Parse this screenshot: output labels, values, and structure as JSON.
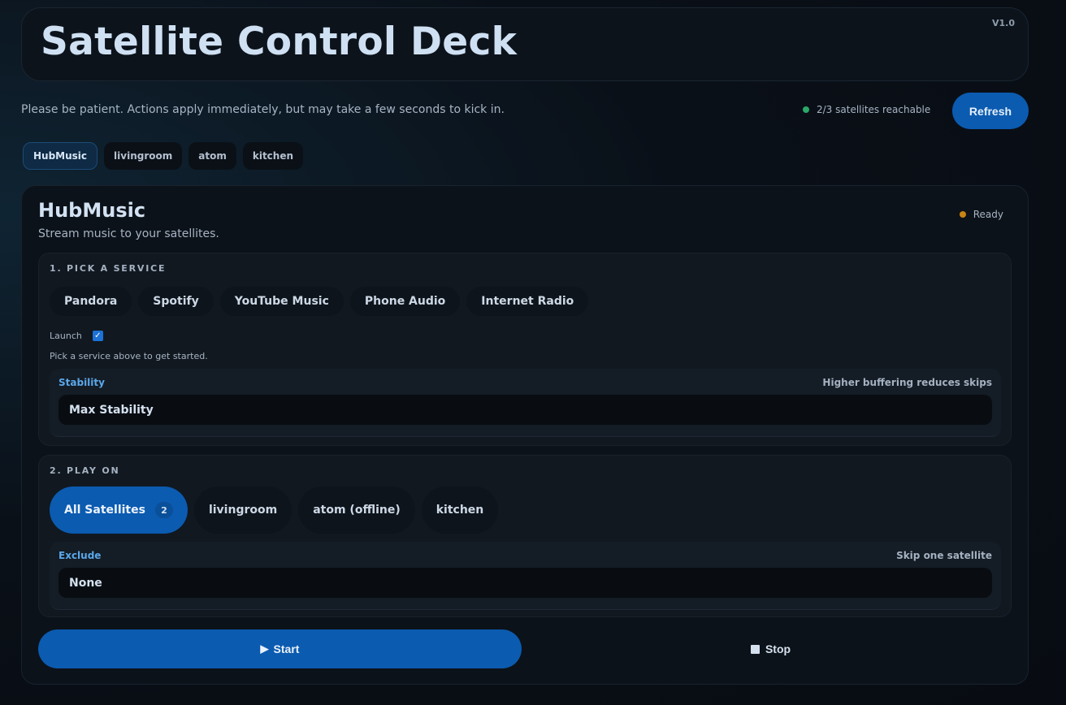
{
  "header": {
    "title": "Satellite Control Deck",
    "version": "V1.0"
  },
  "notice": "Please be patient. Actions apply immediately, but may take a few seconds to kick in.",
  "reachability": {
    "text": "2/3 satellites reachable",
    "color": "#2aa86a"
  },
  "refresh_label": "Refresh",
  "tabs": [
    {
      "label": "HubMusic",
      "active": true
    },
    {
      "label": "livingroom",
      "active": false
    },
    {
      "label": "atom",
      "active": false
    },
    {
      "label": "kitchen",
      "active": false
    }
  ],
  "panel": {
    "title": "HubMusic",
    "subtitle": "Stream music to your satellites.",
    "status": {
      "label": "Ready",
      "color": "#c98512"
    },
    "section1": {
      "title": "1. PICK A SERVICE",
      "services": [
        "Pandora",
        "Spotify",
        "YouTube Music",
        "Phone Audio",
        "Internet Radio"
      ],
      "launch_label": "Launch",
      "launch_checked": true,
      "hint": "Pick a service above to get started.",
      "stability": {
        "label": "Stability",
        "hint": "Higher buffering reduces skips",
        "value": "Max Stability"
      }
    },
    "section2": {
      "title": "2. PLAY ON",
      "targets": [
        {
          "label": "All Satellites",
          "count": "2",
          "selected": true
        },
        {
          "label": "livingroom",
          "selected": false
        },
        {
          "label": "atom (offline)",
          "selected": false
        },
        {
          "label": "kitchen",
          "selected": false
        }
      ],
      "exclude": {
        "label": "Exclude",
        "hint": "Skip one satellite",
        "value": "None"
      }
    },
    "start_label": "Start",
    "stop_label": "Stop"
  },
  "colors": {
    "accent": "#0b5bb0",
    "label_blue": "#5aa8ea"
  }
}
